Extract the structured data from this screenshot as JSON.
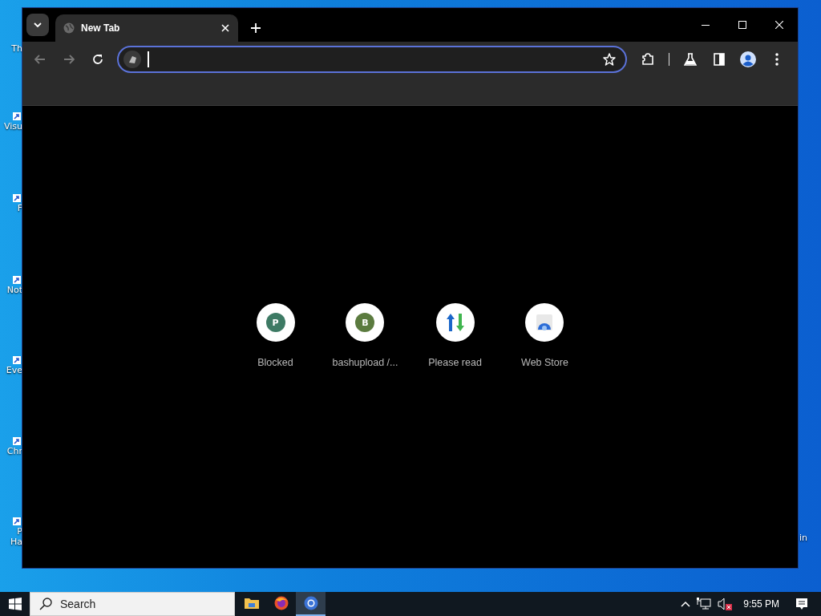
{
  "desktop": {
    "icons": [
      {
        "label": "Th"
      },
      {
        "label": "Visu"
      },
      {
        "label": "F"
      },
      {
        "label": "Not"
      },
      {
        "label": "Eve"
      },
      {
        "label": "Chr"
      },
      {
        "label": "P Ha"
      }
    ],
    "edge_label": "in"
  },
  "browser": {
    "tabs": [
      {
        "title": "New Tab",
        "selected": true
      }
    ],
    "omnibox": {
      "focused": true
    },
    "shortcuts": [
      {
        "kind": "letter",
        "letter": "P",
        "color": "#3d7a64",
        "label": "Blocked"
      },
      {
        "kind": "letter",
        "letter": "B",
        "color": "#5b7b3f",
        "label": "bashupload /..."
      },
      {
        "kind": "arrows",
        "label": "Please read"
      },
      {
        "kind": "store",
        "label": "Web Store"
      }
    ]
  },
  "taskbar": {
    "search": {
      "placeholder": "Search"
    },
    "apps": [
      {
        "kind": "folder",
        "selected": false
      },
      {
        "kind": "firefox",
        "selected": false
      },
      {
        "kind": "chrome",
        "selected": true
      }
    ],
    "volume_muted": true,
    "clock": "9:55 PM"
  }
}
